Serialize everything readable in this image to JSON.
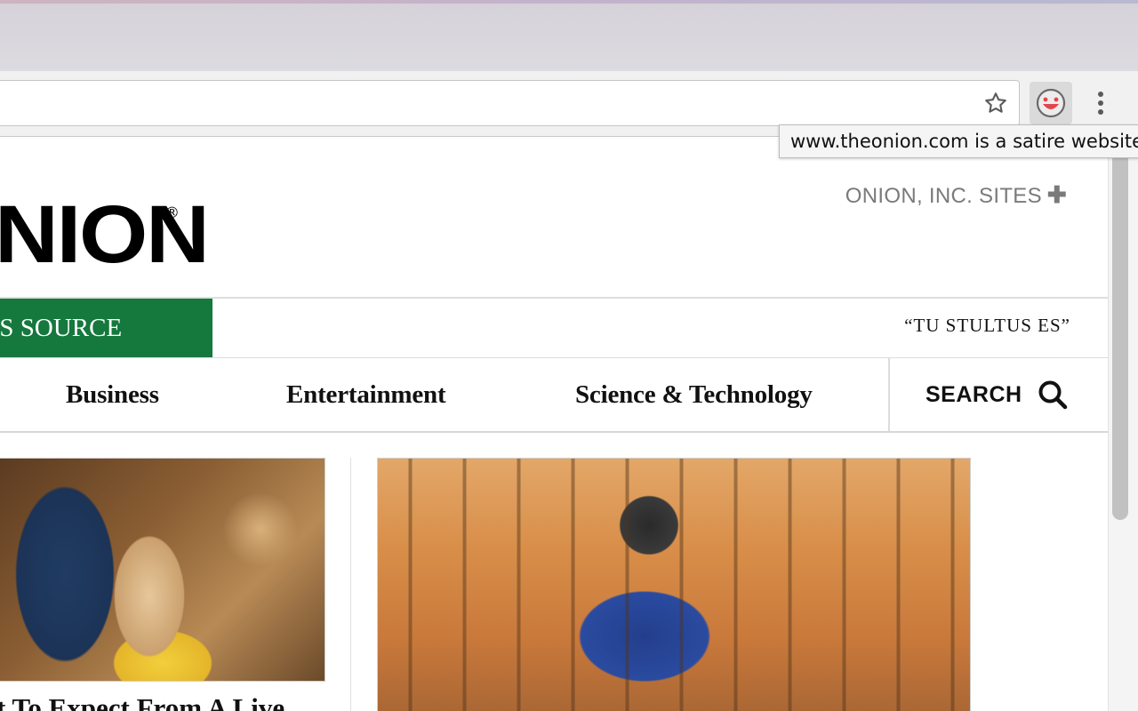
{
  "browser": {
    "tooltip": "www.theonion.com is a satire website"
  },
  "site": {
    "logo_text": "NION",
    "logo_mark": "®",
    "sites_link": "ONION, INC. SITES",
    "tag_band": "WS SOURCE",
    "motto": "“TU STULTUS ES”"
  },
  "nav": {
    "items": [
      {
        "label": "Business"
      },
      {
        "label": "Entertainment"
      },
      {
        "label": "Science & Technology"
      }
    ],
    "search_label": "SEARCH"
  },
  "articles": [
    {
      "headline": "t To Expect From A Live"
    },
    {
      "headline": ""
    }
  ],
  "colors": {
    "brand_green": "#15783d",
    "muted_gray": "#7a7a7a"
  }
}
